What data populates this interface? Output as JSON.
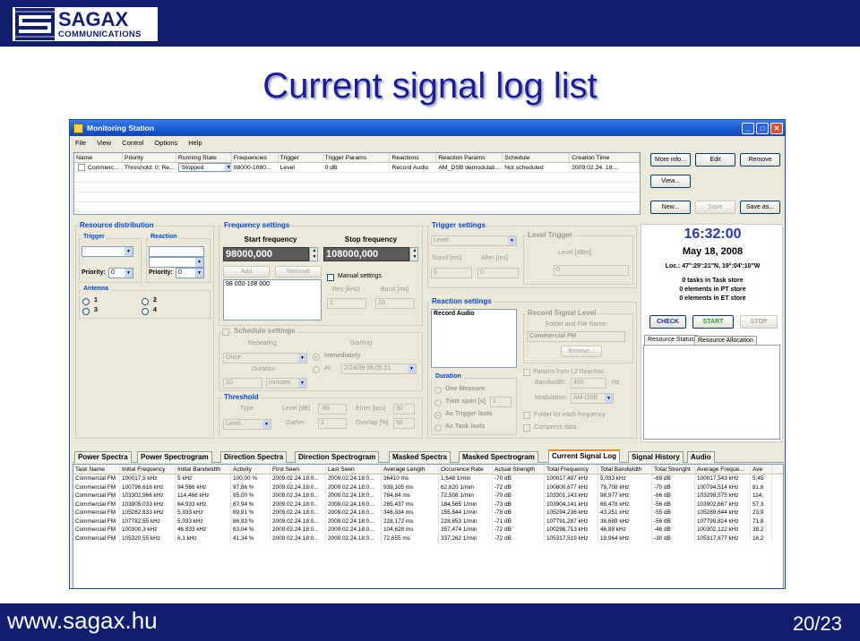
{
  "slide": {
    "brand_name": "SAGAX",
    "brand_sub": "COMMUNICATIONS",
    "title": "Current signal log list",
    "footer_url": "www.sagax.hu",
    "page": "20/23"
  },
  "window": {
    "title": "Monitoring Station",
    "menu": [
      "File",
      "View",
      "Control",
      "Options",
      "Help"
    ],
    "controls": [
      "_",
      "□",
      "✕"
    ]
  },
  "top_grid": {
    "columns": [
      "Name",
      "Priority",
      "Running State",
      "Frequencies",
      "Trigger",
      "Trigger Params",
      "Reactions",
      "Reaction Params",
      "Schedule",
      "Creation Time"
    ],
    "row": [
      "Commerc...",
      "Threshold: 0; Re...",
      "Stopped",
      "98000-1080...",
      "Level",
      "0 dB",
      "Record Audio",
      "AM_DSB demodulati...",
      "Not scheduled",
      "2009.02.24. 18:..."
    ]
  },
  "right_buttons": {
    "more_info": "More info...",
    "edit": "Edit",
    "remove": "Remove",
    "view": "View...",
    "new": "New...",
    "save": "Save",
    "save_as": "Save as..."
  },
  "resource": {
    "title": "Resource distribution",
    "trigger": "Trigger",
    "reaction": "Reaction",
    "priority_label": "Priority:",
    "priority_trigger": "0",
    "priority_reaction": "0",
    "antenna": "Antenna",
    "antennas": [
      "1",
      "2",
      "3",
      "4"
    ]
  },
  "frequency": {
    "title": "Frequency settings",
    "start_label": "Start frequency",
    "stop_label": "Stop frequency",
    "start_value": "98000,000",
    "stop_value": "108000,000",
    "add": "Add",
    "remove": "Remove",
    "list_item": "98 000-108 000",
    "manual": "Manual settings",
    "res_label": "Res [kHz]",
    "res_value": "1",
    "burst_label": "Burst [ms]",
    "burst_value": "10"
  },
  "schedule": {
    "title": "Schedule settings",
    "repeating": "Repeating",
    "starting": "Starting",
    "once": "Once",
    "immediately": "Immediately",
    "duration": "Duration",
    "at": "At:",
    "at_value": "2/24/09 06:05:21",
    "duration_value": "10",
    "duration_unit": "minutes"
  },
  "threshold": {
    "title": "Threshold",
    "type": "Type",
    "level_db": "Level [dB]",
    "level_value": "-80",
    "enter_pcs": "Enter [pcs]",
    "enter_value": "30",
    "type_value": "Level",
    "gather": "Gather",
    "gather_value": "1",
    "overlap": "Overlap [%]",
    "overlap_value": "50"
  },
  "trigger": {
    "title": "Trigger settings",
    "type_value": "Level",
    "level_trigger": "Level Trigger",
    "stand": "Stand [ms]",
    "after": "After [ms]",
    "level_dbm": "Level [dBm]",
    "stand_value": "0",
    "after_value": "0",
    "level_value": "0"
  },
  "reaction": {
    "title": "Reaction settings",
    "list_item": "Record Audio",
    "record_level": "Record Signal Level",
    "folder_label": "Folder and File Name:",
    "folder_value": "Commercial FM",
    "browse": "Browse...",
    "duration_title": "Duration",
    "one_measure": "One Measure",
    "time_span": "Time span [s]",
    "time_span_value": "1",
    "as_trigger": "As Trigger lasts",
    "as_task": "As Task lasts",
    "params_l2": "Params from L2 Reaction",
    "bandwidth": "Bandwidth:",
    "bandwidth_value": "400",
    "hz": "Hz",
    "modulation": "Modulation:",
    "modulation_value": "AM-DSB",
    "folder_each": "Folder for each frequency",
    "compress": "Compress data"
  },
  "status": {
    "time": "16:32:00",
    "date": "May 18, 2008",
    "location": "Loc.: 47°:29':21\"N, 19°:04':10\"W",
    "lines": [
      "0 tasks in Task store",
      "0 elements in PT store",
      "0 elements in ET store"
    ],
    "check": "CHECK",
    "start": "START",
    "stop": "STOP",
    "tabs": [
      "Resource Status",
      "Resource Allocation"
    ],
    "colors": {
      "check": "#1a2fa0",
      "start": "#2a9a2a",
      "stop": "#a0a0a0"
    }
  },
  "bottom_tabs": [
    "Power Spectra",
    "Power Spectrogram",
    "Direction Spectra",
    "Direction Spectrogram",
    "Masked Spectra",
    "Masked Spectrogram",
    "Current Signal Log",
    "Signal History",
    "Audio"
  ],
  "log_table": {
    "columns": [
      "Task Name",
      "Initial Frequency",
      "Initial Bandwidth",
      "Activity",
      "First Seen",
      "Last Seen",
      "Average Length",
      "Occurence Rate",
      "Actual Strength",
      "Total Frequency",
      "Total Bandwidth",
      "Total Strenght",
      "Average Freque...",
      "Ave"
    ],
    "rows": [
      [
        "Commercial FM",
        "100017,5 kHz",
        "5 kHz",
        "100,00 %",
        "2009.02.24.18:0...",
        "2009.02.24.18:0...",
        "36410 ms",
        "1,648 1/min",
        "-70 dB",
        "100017,487 kHz",
        "5,033 kHz",
        "-69 dB",
        "100017,543 kHz",
        "5,45"
      ],
      [
        "Commercial FM",
        "100796,616 kHz",
        "94,566 kHz",
        "97,86 %",
        "2009.02.24.18:0...",
        "2009.02.24.18:0...",
        "939,105 ms",
        "62,620 1/min",
        "-72 dB",
        "100800,677 kHz",
        "79,708 kHz",
        "-70 dB",
        "100794,514 kHz",
        "81,6"
      ],
      [
        "Commercial FM",
        "103302,966 kHz",
        "114,466 kHz",
        "95,00 %",
        "2009.02.24.18:0...",
        "2009.02.24.18:0...",
        "784,84 ms",
        "72,508 1/min",
        "-70 dB",
        "103301,143 kHz",
        "98,977 kHz",
        "-66 dB",
        "103299,575 kHz",
        "114,"
      ],
      [
        "Commercial FM",
        "103905,033 kHz",
        "64,933 kHz",
        "87,94 %",
        "2009.02.24.18:0...",
        "2009.02.24.18:0...",
        "285,437 ms",
        "184,565 1/min",
        "-73 dB",
        "103904,141 kHz",
        "68,478 kHz",
        "-56 dB",
        "103902,667 kHz",
        "57,3"
      ],
      [
        "Commercial FM",
        "105282,633 kHz",
        "5,933 kHz",
        "89,91 %",
        "2009.02.24.18:0...",
        "2009.02.24.18:0...",
        "346,034 ms",
        "155,844 1/min",
        "-78 dB",
        "105294,236 kHz",
        "43,251 kHz",
        "-55 dB",
        "105289,644 kHz",
        "23,9"
      ],
      [
        "Commercial FM",
        "107782,55 kHz",
        "5,033 kHz",
        "86,93 %",
        "2009.02.24.18:0...",
        "2009.02.24.18:0...",
        "228,172 ms",
        "228,653 1/min",
        "-71 dB",
        "107791,287 kHz",
        "36,689 kHz",
        "-56 dB",
        "107799,824 kHz",
        "71,8"
      ],
      [
        "Commercial FM",
        "100300,3 kHz",
        "46,933 kHz",
        "63,04 %",
        "2009.02.24.18:0...",
        "2009.02.24.18:0...",
        "104,628 ms",
        "357,474 1/min",
        "-72 dB",
        "100298,713 kHz",
        "46,88 kHz",
        "-46 dB",
        "100302,122 kHz",
        "38,2"
      ],
      [
        "Commercial FM",
        "105320,55 kHz",
        "6,1 kHz",
        "41,34 %",
        "2009.02.24.18:0...",
        "2009.02.24.18:0...",
        "72,655 ms",
        "337,262 1/min",
        "-72 dB",
        "105317,519 kHz",
        "19,964 kHz",
        "-30 dB",
        "105317,677 kHz",
        "16,2"
      ]
    ]
  }
}
